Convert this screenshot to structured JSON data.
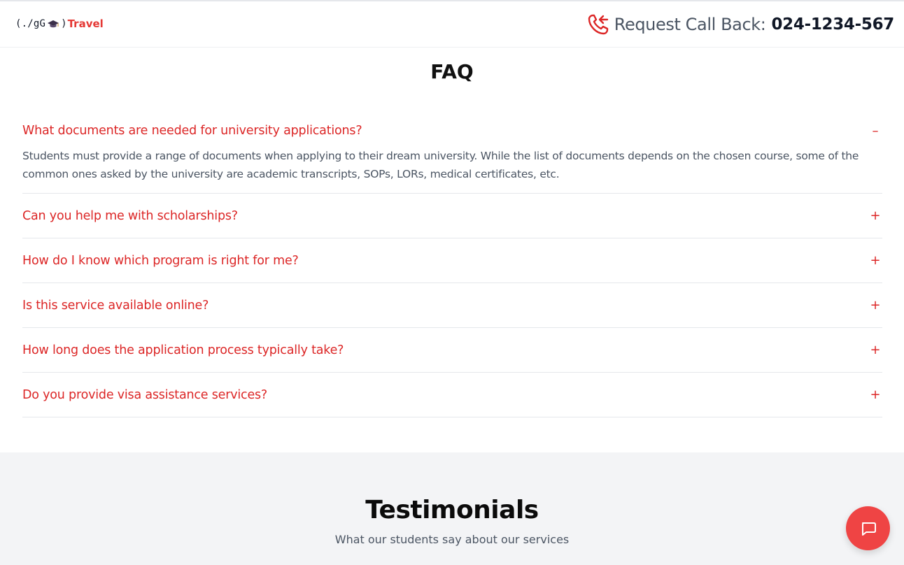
{
  "header": {
    "logo": {
      "code_prefix": "(./gG",
      "code_suffix": ")",
      "brand": "Travel"
    },
    "callback": {
      "label": "Request Call Back:",
      "number": "024-1234-567",
      "icon": "phone-callback-icon"
    }
  },
  "faq": {
    "title": "FAQ",
    "items": [
      {
        "question": "What documents are needed for university applications?",
        "toggle": "–",
        "answer": "Students must provide a range of documents when applying to their dream university. While the list of documents depends on the chosen course, some of the common ones asked by the university are academic transcripts, SOPs, LORs, medical certificates, etc."
      },
      {
        "question": "Can you help me with scholarships?",
        "toggle": "+"
      },
      {
        "question": "How do I know which program is right for me?",
        "toggle": "+"
      },
      {
        "question": "Is this service available online?",
        "toggle": "+"
      },
      {
        "question": "How long does the application process typically take?",
        "toggle": "+"
      },
      {
        "question": "Do you provide visa assistance services?",
        "toggle": "+"
      }
    ]
  },
  "testimonials": {
    "title": "Testimonials",
    "subtitle": "What our students say about our services"
  },
  "colors": {
    "accent": "#dc2626",
    "chat_button": "#ef4444",
    "section_bg": "#f3f4f6"
  },
  "chat": {
    "icon": "chat-bubble-icon"
  }
}
